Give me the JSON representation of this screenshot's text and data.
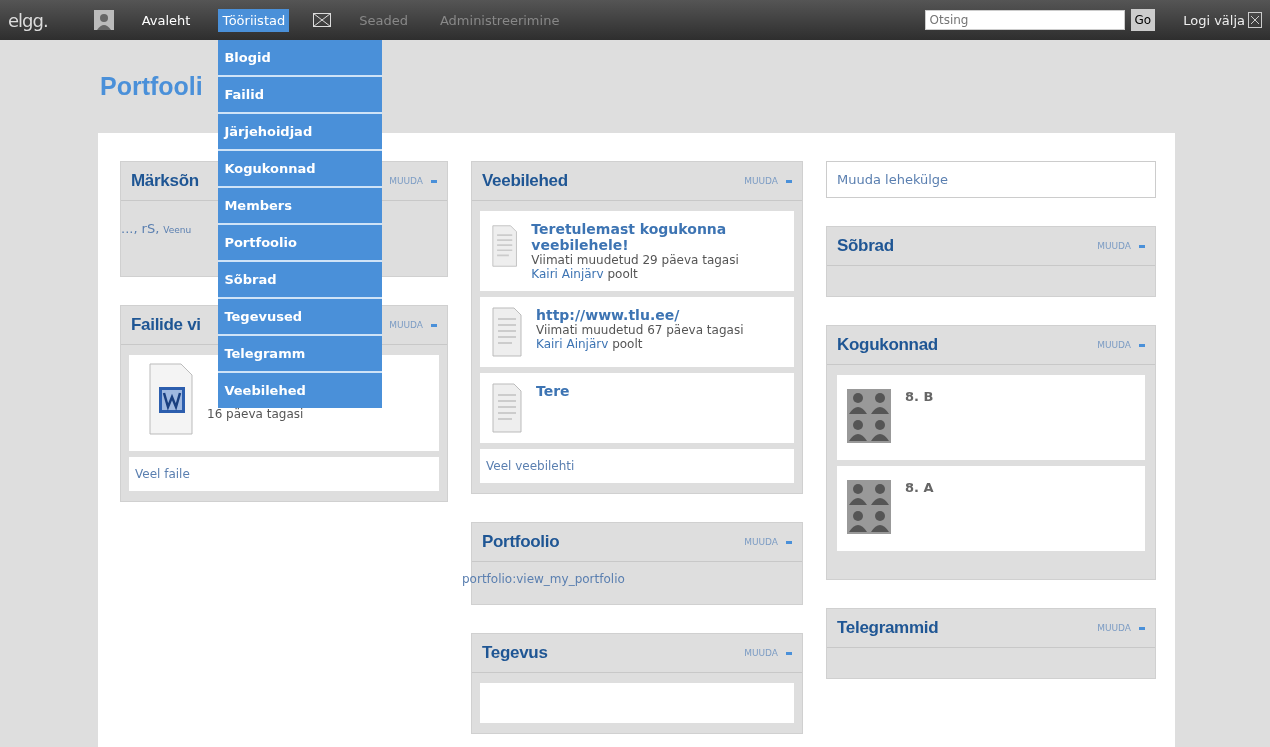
{
  "topbar": {
    "logo": "elgg.",
    "nav": [
      {
        "kind": "avatar"
      },
      {
        "kind": "link",
        "label": "Avaleht",
        "selected": false,
        "dimmed": false
      },
      {
        "kind": "link",
        "label": "Tööriistad",
        "selected": true,
        "dimmed": false,
        "expanded": true,
        "menu": [
          "Blogid",
          "Failid",
          "Järjehoidjad",
          "Kogukonnad",
          "Members",
          "Portfoolio",
          "Sõbrad",
          "Tegevused",
          "Telegramm",
          "Veebilehed"
        ]
      },
      {
        "kind": "mail"
      },
      {
        "kind": "link",
        "label": "Seaded",
        "selected": false,
        "dimmed": true
      },
      {
        "kind": "link",
        "label": "Administreerimine",
        "selected": false,
        "dimmed": true
      }
    ],
    "search": {
      "placeholder": "Otsing",
      "button": "Go"
    },
    "logout": "Logi välja"
  },
  "page_title": "Portfooli",
  "columns": [
    [
      {
        "kind": "tags",
        "title": "Märksõn",
        "edit": "MUUDA",
        "tags": [
          "...,",
          "rS,",
          "Veenu"
        ]
      },
      {
        "kind": "files",
        "title": "Failide vi",
        "edit": "MUUDA",
        "items": [
          {
            "time": "16 päeva tagasi"
          }
        ],
        "more": "Veel faile"
      }
    ],
    [
      {
        "kind": "pages",
        "title": "Veebilehed",
        "edit": "MUUDA",
        "items": [
          {
            "title": "Teretulemast kogukonna veebilehele!",
            "updated": "Viimati muudetud 29 päeva tagasi",
            "author": "Kairi Ainjärv",
            "suffix": " poolt"
          },
          {
            "title": "http://www.tlu.ee/",
            "updated": "Viimati muudetud 67 päeva tagasi",
            "author": "Kairi Ainjärv",
            "suffix": " poolt"
          },
          {
            "title": "Tere"
          }
        ],
        "more": "Veel veebilehti"
      },
      {
        "kind": "text",
        "title": "Portfoolio",
        "edit": "MUUDA",
        "text": "portfolio:view_my_portfolio"
      },
      {
        "kind": "activity",
        "title": "Tegevus",
        "edit": "MUUDA"
      }
    ],
    [
      {
        "kind": "button",
        "label": "Muuda lehekülge"
      },
      {
        "kind": "empty",
        "title": "Sõbrad",
        "edit": "MUUDA"
      },
      {
        "kind": "groups",
        "title": "Kogukonnad",
        "edit": "MUUDA",
        "items": [
          "8. B",
          "8. A"
        ]
      },
      {
        "kind": "empty",
        "title": "Telegrammid",
        "edit": "MUUDA"
      }
    ]
  ]
}
